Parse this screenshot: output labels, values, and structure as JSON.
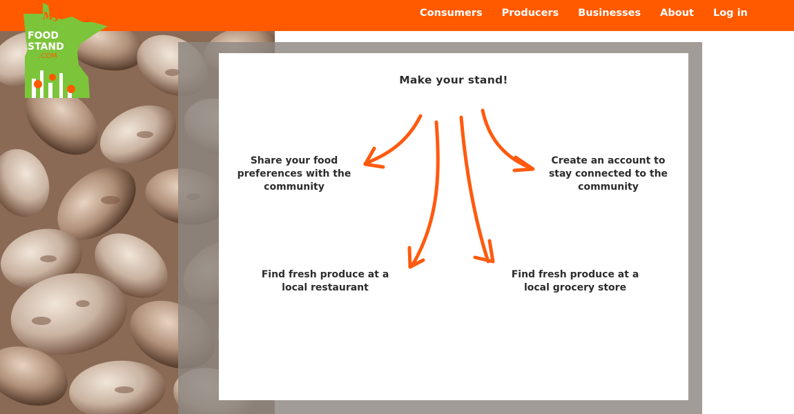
{
  "nav": {
    "items": [
      "Consumers",
      "Producers",
      "Businesses",
      "About",
      "Log in"
    ]
  },
  "logo": {
    "line1": "My",
    "line2": "FOOD",
    "line3": "STAND",
    "line4": ".COM"
  },
  "main": {
    "title": "Make your stand!",
    "options": [
      {
        "id": "share",
        "line1": "Share your food",
        "line2": "preferences with the",
        "line3": "community"
      },
      {
        "id": "account",
        "line1": "Create an account to",
        "line2": "stay connected to the",
        "line3": "community"
      },
      {
        "id": "restaurant",
        "line1": "Find fresh produce at a",
        "line2": "local restaurant"
      },
      {
        "id": "grocery",
        "line1": "Find fresh produce at a",
        "line2": "local grocery store"
      }
    ]
  },
  "colors": {
    "brand_orange": "#ff5a00",
    "logo_green": "#7cc43a",
    "arrow_orange": "#ff5a0f",
    "frame_gray": "#8c8680"
  }
}
